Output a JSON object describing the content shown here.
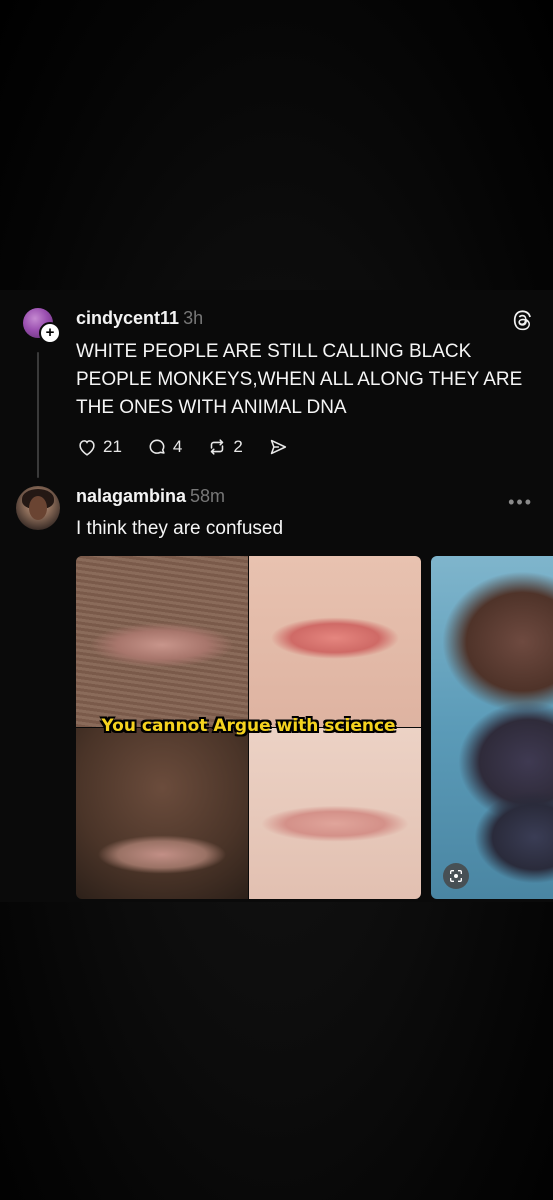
{
  "post": {
    "username": "cindycent11",
    "time": "3h",
    "text": "WHITE PEOPLE ARE STILL CALLING BLACK PEOPLE MONKEYS,WHEN ALL ALONG THEY ARE THE ONES WITH ANIMAL DNA",
    "likes": "21",
    "replies": "4",
    "reposts": "2"
  },
  "reply": {
    "username": "nalagambina",
    "time": "58m",
    "text": "I think they are confused",
    "image_caption": "You cannot Argue with science"
  },
  "icons": {
    "threads_logo": "threads-logo-icon",
    "like": "heart-icon",
    "comment": "comment-icon",
    "repost": "repost-icon",
    "share": "send-icon",
    "more": "more-horizontal-icon",
    "lens": "google-lens-icon"
  }
}
